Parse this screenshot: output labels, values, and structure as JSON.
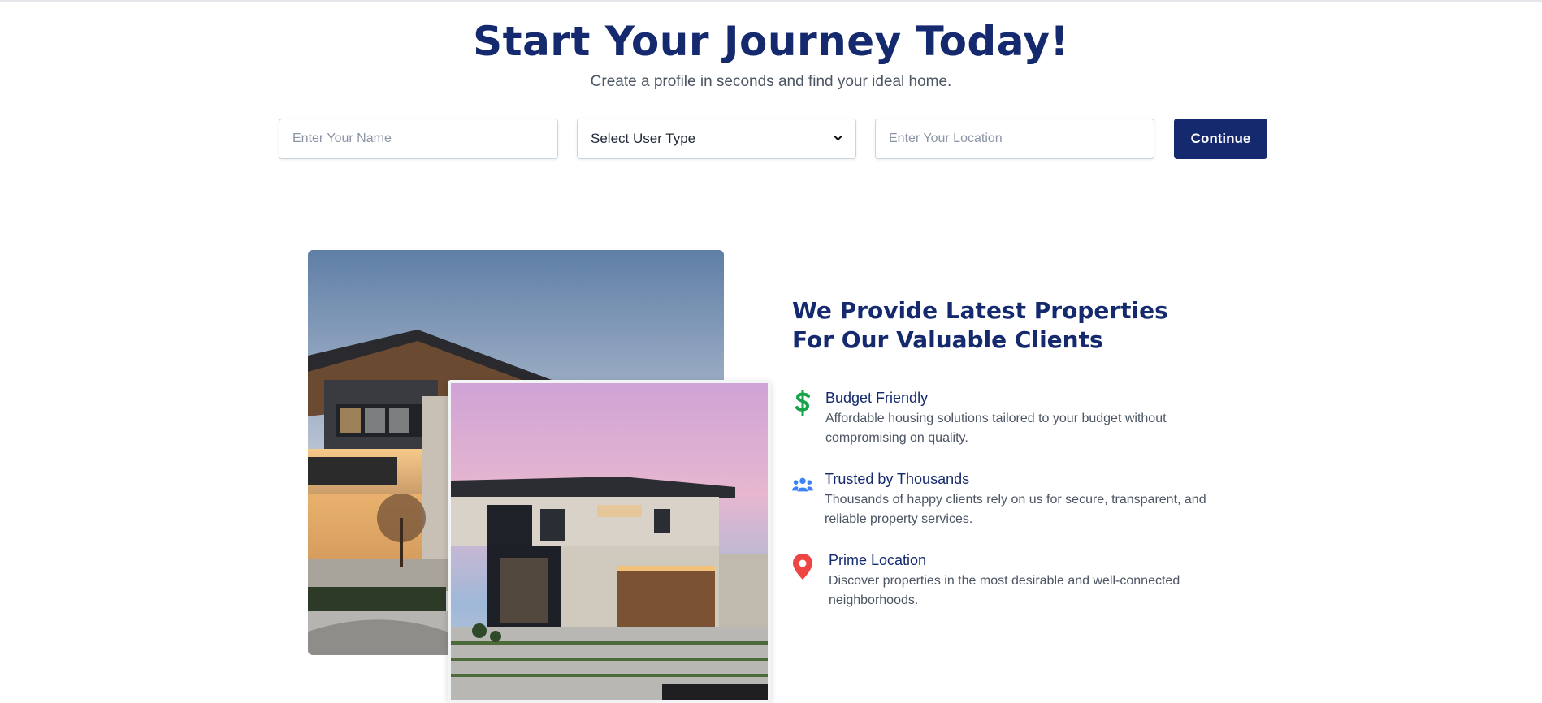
{
  "hero": {
    "title": "Start Your Journey Today!",
    "subtitle": "Create a profile in seconds and find your ideal home."
  },
  "form": {
    "name_placeholder": "Enter Your Name",
    "user_type_selected": "Select User Type",
    "location_placeholder": "Enter Your Location",
    "continue_label": "Continue"
  },
  "features_section": {
    "title_line1": "We Provide Latest Properties",
    "title_line2": "For Our Valuable Clients",
    "items": [
      {
        "icon": "dollar-icon",
        "icon_color": "#16a34a",
        "title": "Budget Friendly",
        "description": "Affordable housing solutions tailored to your budget without compromising on quality."
      },
      {
        "icon": "users-icon",
        "icon_color": "#3b82f6",
        "title": "Trusted by Thousands",
        "description": "Thousands of happy clients rely on us for secure, transparent, and reliable property services."
      },
      {
        "icon": "map-pin-icon",
        "icon_color": "#ef4444",
        "title": "Prime Location",
        "description": "Discover properties in the most desirable and well-connected neighborhoods."
      }
    ]
  },
  "colors": {
    "brand_navy": "#152a6e",
    "text_muted": "#4b5563"
  }
}
